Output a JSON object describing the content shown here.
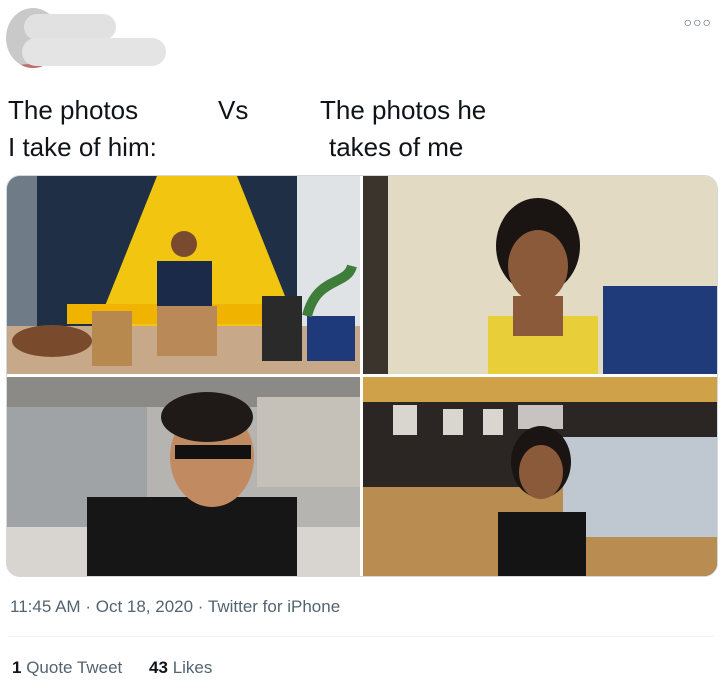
{
  "tweet": {
    "text_left": [
      "The photos",
      "I take of him:"
    ],
    "text_vs": "Vs",
    "text_right": [
      "The photos he",
      "takes of me"
    ],
    "time": "11:45 AM",
    "sep1": "·",
    "date": "Oct 18, 2020",
    "sep2": "·",
    "source": "Twitter for iPhone",
    "more_icon": "more-icon"
  },
  "stats": {
    "quote_count": "1",
    "quote_label": "Quote Tweet",
    "likes_count": "43",
    "likes_label": "Likes"
  },
  "colors": {
    "text": "#0f1419",
    "muted": "#536471",
    "divider": "#eff3f4"
  }
}
